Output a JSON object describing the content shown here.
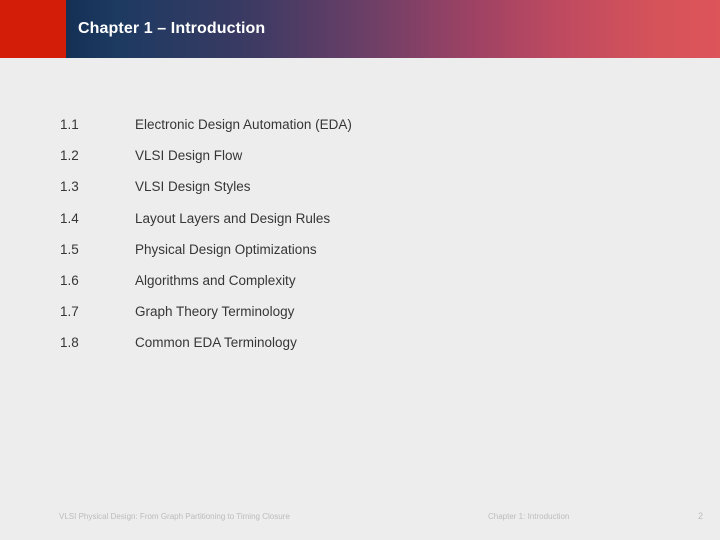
{
  "slide": {
    "background_color": "#ededed",
    "header": {
      "title": "Chapter 1 – Introduction",
      "accent_color": "#d41d08",
      "gradient_start_color": "#143055",
      "gradient_mid_color": "#9d4264",
      "gradient_end_color": "#dd5459",
      "title_color": "#ffffff"
    },
    "toc": {
      "text_color": "#363636",
      "items": [
        {
          "number": "1.1",
          "label": "Electronic Design Automation (EDA)"
        },
        {
          "number": "1.2",
          "label": "VLSI Design Flow"
        },
        {
          "number": "1.3",
          "label": "VLSI Design Styles"
        },
        {
          "number": "1.4",
          "label": "Layout Layers and Design Rules"
        },
        {
          "number": "1.5",
          "label": "Physical Design Optimizations"
        },
        {
          "number": "1.6",
          "label": "Algorithms and Complexity"
        },
        {
          "number": "1.7",
          "label": "Graph Theory Terminology"
        },
        {
          "number": "1.8",
          "label": "Common EDA Terminology"
        }
      ]
    },
    "footer": {
      "book_title": "VLSI Physical Design: From Graph Partitioning to Timing Closure",
      "chapter": "Chapter 1: Introduction",
      "page_number": "2",
      "text_color": "#bcbcbc"
    }
  }
}
